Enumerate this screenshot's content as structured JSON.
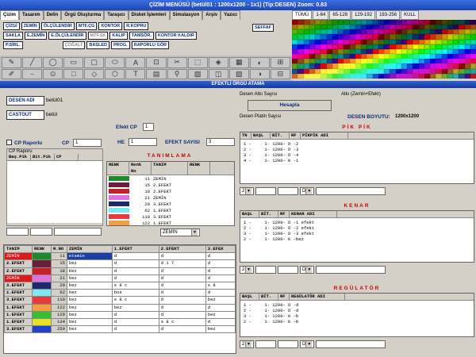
{
  "title": "ÇİZİM MENÜSÜ   (betül01 : 1200x1200 - 1x1) (Tip:DESEN) Zoom: 0.83",
  "tabs": [
    "Çizim",
    "Tasarım",
    "Delin",
    "Örgü Oluşturma",
    "Taraşıcı",
    "Disket İşlemleri",
    "Simulasyon",
    "Arşiv",
    "Yazıcı"
  ],
  "palette_tabs": [
    "TÜMÜ",
    "1-64",
    "65-128",
    "129-192",
    "193-256",
    "KULL"
  ],
  "buttons_row1": [
    "ÇİZGİ",
    "ZEMİN",
    "ÖLÇÜLENDİR",
    "MTF.ÇG",
    "KONTOR",
    "R.KOPRU"
  ],
  "buttons_row2": [
    "SAKLA",
    "E.ZEMİN",
    "E.ÖLÇÜLENDİR",
    "MTF.SK",
    "KALIP",
    "TAMSÖR.",
    "KONTOR KALDIR"
  ],
  "buttons_row3": [
    "P.SİRL.",
    "",
    "",
    "ÇOĞALT",
    "BASLED",
    "PROG.",
    "RAPORLU GÖR"
  ],
  "side_button": "SEFFAF",
  "tool_glyphs": [
    "✎",
    "╱",
    "◯",
    "▭",
    "▢",
    "⬭",
    "A",
    "⊡",
    "✂",
    "⬚",
    "◈",
    "▦",
    "◐",
    "⊞",
    "✐",
    "⎯",
    "⊙",
    "□",
    "◇",
    "⬡",
    "T",
    "▤",
    "⚲",
    "▧",
    "◫",
    "▨",
    "◑",
    "⊟"
  ],
  "section_title": "EFEKTLİ ÖRGÜ ATAMA",
  "left": {
    "desen_adi_label": "DESEN ADI",
    "desen_adi": "betül01",
    "castout_label": "CASTOUT",
    "castout": "betül",
    "efekt_cp_label": "Efekt CP",
    "efekt_cp": "1",
    "cp_raporlu_label": "CP Raporlu",
    "cp_label": "CP",
    "cp_val": "1",
    "he_label": "HE",
    "he_val": "1",
    "efekt_sayisi_label": "EFEKT SAYISI",
    "efekt_sayisi": "3",
    "cp_raporu_label": "CP Raporu",
    "cp_cols": [
      "Baş.Pik",
      "Bit.Pik",
      "CP"
    ]
  },
  "tanimlama": {
    "title": "TANIMLAMA",
    "cols": [
      "RENK",
      "Renk No",
      "TANIM",
      "RENK"
    ],
    "rows": [
      {
        "color": "#1a8a2a",
        "no": "11",
        "name": "ZEMİN"
      },
      {
        "color": "#6a1e3a",
        "no": "15",
        "name": "2.EFEKT"
      },
      {
        "color": "#c81e28",
        "no": "18",
        "name": "2.EFEKT"
      },
      {
        "color": "#e070e0",
        "no": "21",
        "name": "ZEMİN"
      },
      {
        "color": "#1a2a6a",
        "no": "20",
        "name": "3.EFEKT"
      },
      {
        "color": "#80e8f0",
        "no": "62",
        "name": "1.EFEKT"
      },
      {
        "color": "#e83a3a",
        "no": "110",
        "name": "3.EFEKT"
      },
      {
        "color": "#f0a040",
        "no": "122",
        "name": "1.EFEKT"
      }
    ],
    "select": "ZEMİN"
  },
  "right": {
    "desen_atki_label": "Desen Atkı Sayısı",
    "atki_label": "Atkı (Zemin+Efekt)",
    "hesapla": "Hesapla",
    "desen_platin_label": "Desen Platin Sayısı",
    "desen_boyutu_label": "DESEN BOYUTU:",
    "desen_boyutu": "1200x1200"
  },
  "pikpik": {
    "title": "PİK PİK",
    "cols": [
      "TN",
      "BAŞL",
      "BİT.",
      "RF",
      "PİKPİK ADI"
    ],
    "lines": [
      "1 -     1- 1200- D -2",
      "2 -     1- 1200- D -3",
      "3 -     1- 1200- D -4",
      "4 -     1- 1200- K -1"
    ],
    "combo1": "2",
    "combo2": "D"
  },
  "kenar": {
    "title": "KENAR",
    "cols": [
      "BAŞL",
      "BİT.",
      "RF",
      "KENAR ADI"
    ],
    "lines": [
      "1 -     1- 1200- D -1 efekt",
      "2 -     1- 1200- D -2 efekt",
      "3 -     1- 1200- D -3 efekt",
      "2 -     1- 1200- K -bez"
    ],
    "combo1": "2",
    "combo2": "D"
  },
  "regulator": {
    "title": "REGÜLATÖR",
    "cols": [
      "BAŞL",
      "BİT.",
      "RF",
      "REGÜLATÖR ADI"
    ],
    "lines": [
      "1 -     1- 1200- D -d",
      "2 -     1- 1200- D -d",
      "3 -     1- 1200- K -b",
      "2 -     1- 1200- K -b"
    ],
    "combo1": "2",
    "combo2": "D"
  },
  "main_table": {
    "cols": [
      "TANIM",
      "RENK",
      "R.NO",
      "ZEMİN",
      "1.EFEKT",
      "2.EFEKT",
      "3.EFEK"
    ],
    "rows": [
      {
        "tanim": "ZEMİN",
        "tanim_red": true,
        "color": "#1a8a2a",
        "no": "11",
        "zemin": "etamin",
        "e1": "d",
        "e2": "d",
        "e3": "d",
        "sel": true
      },
      {
        "tanim": "2.EFEKT",
        "tanim_red": false,
        "color": "#6a1e3a",
        "no": "15",
        "zemin": "bez",
        "e1": "d",
        "e2": "d 1 7",
        "e3": "d",
        "sel": false
      },
      {
        "tanim": "2.EFEKT",
        "tanim_red": false,
        "color": "#c81e28",
        "no": "18",
        "zemin": "bez",
        "e1": "d",
        "e2": "d",
        "e3": "d",
        "sel": false
      },
      {
        "tanim": "ZEMİN",
        "tanim_red": true,
        "color": "#e070e0",
        "no": "21",
        "zemin": "bez",
        "e1": "d",
        "e2": "d",
        "e3": "d",
        "sel": false
      },
      {
        "tanim": "3.EFEKT",
        "tanim_red": false,
        "color": "#1a2a6a",
        "no": "20",
        "zemin": "bez",
        "e1": "s 8 c",
        "e2": "d",
        "e3": "s 8",
        "sel": false
      },
      {
        "tanim": "1.EFEKT",
        "tanim_red": false,
        "color": "#80e8f0",
        "no": "62",
        "zemin": "bez",
        "e1": "bos",
        "e2": "d",
        "e3": "d",
        "sel": false
      },
      {
        "tanim": "3.EFEKT",
        "tanim_red": false,
        "color": "#e83a3a",
        "no": "110",
        "zemin": "bez",
        "e1": "s 8 c",
        "e2": "d",
        "e3": "bez",
        "sel": false
      },
      {
        "tanim": "1.EFEKT",
        "tanim_red": false,
        "color": "#f0a040",
        "no": "122",
        "zemin": "bez",
        "e1": "bez",
        "e2": "d",
        "e3": "d",
        "sel": false
      },
      {
        "tanim": "1.EFEKT",
        "tanim_red": false,
        "color": "#30c030",
        "no": "129",
        "zemin": "bez",
        "e1": "d",
        "e2": "d",
        "e3": "bez",
        "sel": false
      },
      {
        "tanim": "1.EFEKT",
        "tanim_red": false,
        "color": "#e8e020",
        "no": "134",
        "zemin": "bez",
        "e1": "d",
        "e2": "s 8 c",
        "e3": "d",
        "sel": false
      },
      {
        "tanim": "3.EFEKT",
        "tanim_red": false,
        "color": "#2040d0",
        "no": "250",
        "zemin": "bez",
        "e1": "d",
        "e2": "d",
        "e3": "bez",
        "sel": false
      }
    ]
  },
  "palette_colors": [
    "#ff0000",
    "#ff4000",
    "#ff8000",
    "#ffc000",
    "#ffff00",
    "#c0ff00",
    "#80ff00",
    "#40ff00",
    "#00ff00",
    "#00ff40",
    "#00ff80",
    "#00ffc0",
    "#00ffff",
    "#00c0ff",
    "#0080ff",
    "#0040ff",
    "#0000ff",
    "#4000ff",
    "#8000ff",
    "#c000ff",
    "#ff00ff",
    "#ff00c0",
    "#ff0080",
    "#ff0040",
    "#800000",
    "#804000",
    "#808000",
    "#408000",
    "#008040",
    "#008080",
    "#004080",
    "#400080"
  ]
}
